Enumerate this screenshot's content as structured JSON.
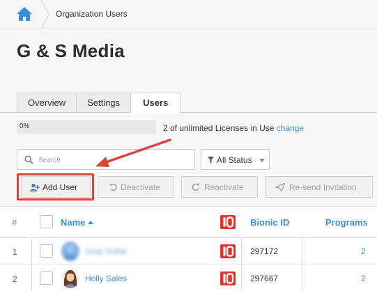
{
  "breadcrumb": {
    "current": "Organization Users"
  },
  "page": {
    "title": "G & S Media"
  },
  "tabs": [
    {
      "label": "Overview",
      "active": false
    },
    {
      "label": "Settings",
      "active": false
    },
    {
      "label": "Users",
      "active": true
    }
  ],
  "license": {
    "progress_label": "0%",
    "progress_value": 0,
    "text": "2 of unlimited Licenses in Use",
    "change_link": "change"
  },
  "search": {
    "placeholder": "Search"
  },
  "status_filter": {
    "selected": "All Status"
  },
  "toolbar": {
    "add_user": "Add User",
    "deactivate": "Deactivate",
    "reactivate": "Reactivate",
    "resend": "Re-send Invitation"
  },
  "table": {
    "headers": {
      "index": "#",
      "name": "Name",
      "bionic_id": "Bionic ID",
      "programs": "Programs"
    },
    "rows": [
      {
        "index": "1",
        "name": "Gray Dollar",
        "bionic_id": "297172",
        "programs": "2",
        "blurred": true
      },
      {
        "index": "2",
        "name": "Holly Sales",
        "bionic_id": "297667",
        "programs": "2",
        "blurred": false
      }
    ]
  },
  "colors": {
    "accent": "#3a8fd6",
    "highlight": "#d9453b",
    "io_brand": "#e0352b"
  },
  "icons": [
    "home-icon",
    "search-icon",
    "filter-icon",
    "add-user-icon",
    "undo-icon",
    "refresh-icon",
    "send-icon",
    "io-icon"
  ]
}
